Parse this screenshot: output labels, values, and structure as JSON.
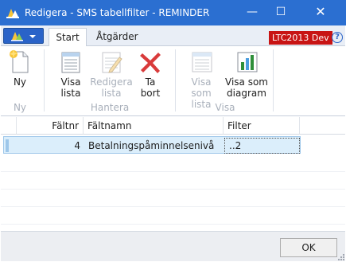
{
  "window": {
    "title": "Redigera - SMS tabellfilter - REMINDER",
    "minimize_glyph": "—",
    "maximize_glyph": "☐",
    "close_glyph": "✕"
  },
  "ribbon_tabs": {
    "start": "Start",
    "atgarder": "Åtgärder"
  },
  "environment_badge": "LTC2013 Dev",
  "help_glyph": "?",
  "ribbon": {
    "groups": {
      "ny": "Ny",
      "hantera": "Hantera",
      "visa": "Visa"
    },
    "buttons": {
      "ny": "Ny",
      "visa_lista_1": "Visa",
      "visa_lista_2": "lista",
      "redigera_lista_1": "Redigera",
      "redigera_lista_2": "lista",
      "ta_bort_1": "Ta",
      "ta_bort_2": "bort",
      "visa_som_lista_1": "Visa",
      "visa_som_lista_2": "som lista",
      "visa_som_diagram_1": "Visa som",
      "visa_som_diagram_2": "diagram"
    }
  },
  "grid": {
    "columns": {
      "faltnr": "Fältnr",
      "faltnamn": "Fältnamn",
      "filter": "Filter"
    },
    "rows": [
      {
        "faltnr": "4",
        "faltnamn": "Betalningspåminnelsenivå",
        "filter": "..2"
      }
    ]
  },
  "footer": {
    "ok_label": "OK"
  },
  "colors": {
    "titlebar": "#2b6fd1",
    "env_badge": "#c81414",
    "selected_row": "#dbeefb"
  }
}
